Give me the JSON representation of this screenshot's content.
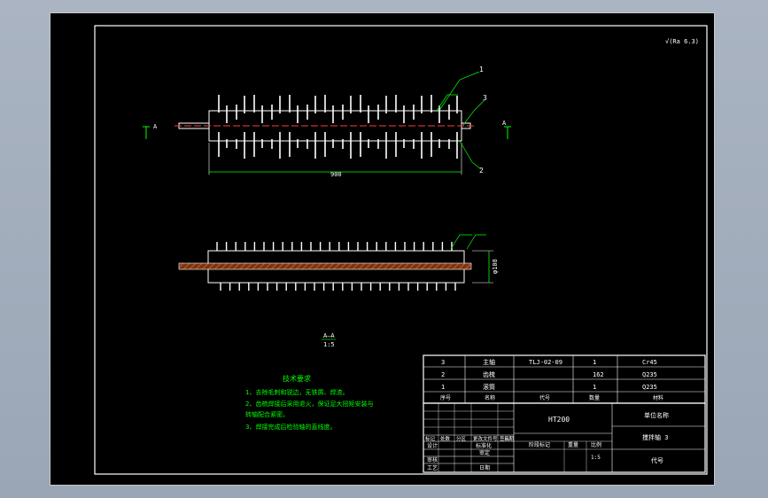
{
  "roughness_note": "√(Ra 6.3)",
  "views": {
    "balloons": [
      "1",
      "3",
      "2"
    ],
    "length_dim": "900",
    "section_marks": [
      "A",
      "A"
    ],
    "diameter_dim": "φ108",
    "section_title": "A—A",
    "section_scale": "1:5"
  },
  "tech_requirements": {
    "title": "技术要求",
    "items": [
      "1、去除毛刺和锐边，无铁屑、焊渣。",
      "2、齿梳焊接后采用退火，保证足大扭矩安装与",
      "   转轴配合紧密。",
      "3、焊接完成后检验轴的直线度。"
    ]
  },
  "parts_list": {
    "rows": [
      {
        "no": "3",
        "name": "主轴",
        "code": "TLJ-02-09",
        "qty": "1",
        "material": "Cr45"
      },
      {
        "no": "2",
        "name": "齿梳",
        "code": "",
        "qty": "162",
        "material": "Q235"
      },
      {
        "no": "1",
        "name": "滚筒",
        "code": "",
        "qty": "1",
        "material": "Q235"
      }
    ],
    "header": {
      "no": "序号",
      "name": "名称",
      "code": "代号",
      "qty": "数量",
      "material": "材料"
    }
  },
  "title_block": {
    "material": "HT200",
    "unit": "单位名称",
    "drawing_name": "搅拌轴 3",
    "drawing_code": "代号",
    "scale": "1:5",
    "mark_row": [
      "标记",
      "处数",
      "分区",
      "更改文件号",
      "签名",
      "日期"
    ],
    "roles": [
      "设计",
      "审核",
      "工艺"
    ],
    "role_right": [
      "标准化",
      "审定",
      "日期"
    ],
    "stage_label": "阶段标记",
    "weight_label": "重量",
    "scale_label": "比例"
  }
}
